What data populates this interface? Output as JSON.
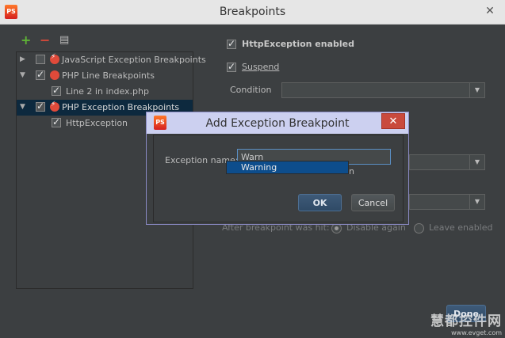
{
  "window": {
    "title": "Breakpoints",
    "close_glyph": "✕",
    "app_icon_text": "PS"
  },
  "toolbar": {
    "add_glyph": "+",
    "remove_glyph": "−",
    "edit_glyph": "▤"
  },
  "tree": [
    {
      "label": "JavaScript Exception Breakpoints",
      "checked": false
    },
    {
      "label": "PHP Line Breakpoints",
      "checked": true
    },
    {
      "label": "Line 2 in index.php",
      "checked": true
    },
    {
      "label": "PHP Exception Breakpoints",
      "checked": true
    },
    {
      "label": "HttpException",
      "checked": true
    }
  ],
  "settings": {
    "enabled_label": "HttpException enabled",
    "suspend_label": "Suspend",
    "condition_label": "Condition",
    "condition_value": "",
    "after_hit_label": "After breakpoint was hit:",
    "disable_again_label": "Disable again",
    "leave_enabled_label": "Leave enabled",
    "done_label": "Done"
  },
  "dialog": {
    "title": "Add Exception Breakpoint",
    "close_glyph": "✕",
    "exception_name_label": "Exception name:",
    "exception_name_value": "Warn",
    "hidden_suffix": "n",
    "popup_item": "Warning",
    "ok_label": "OK",
    "cancel_label": "Cancel"
  },
  "watermark": {
    "main": "慧都控件网",
    "sub": "www.evget.com"
  },
  "colors": {
    "accent": "#0d4d8c",
    "add_green": "#5fb336",
    "remove_red": "#d94a3a",
    "breakpoint_red": "#e04a3a"
  }
}
